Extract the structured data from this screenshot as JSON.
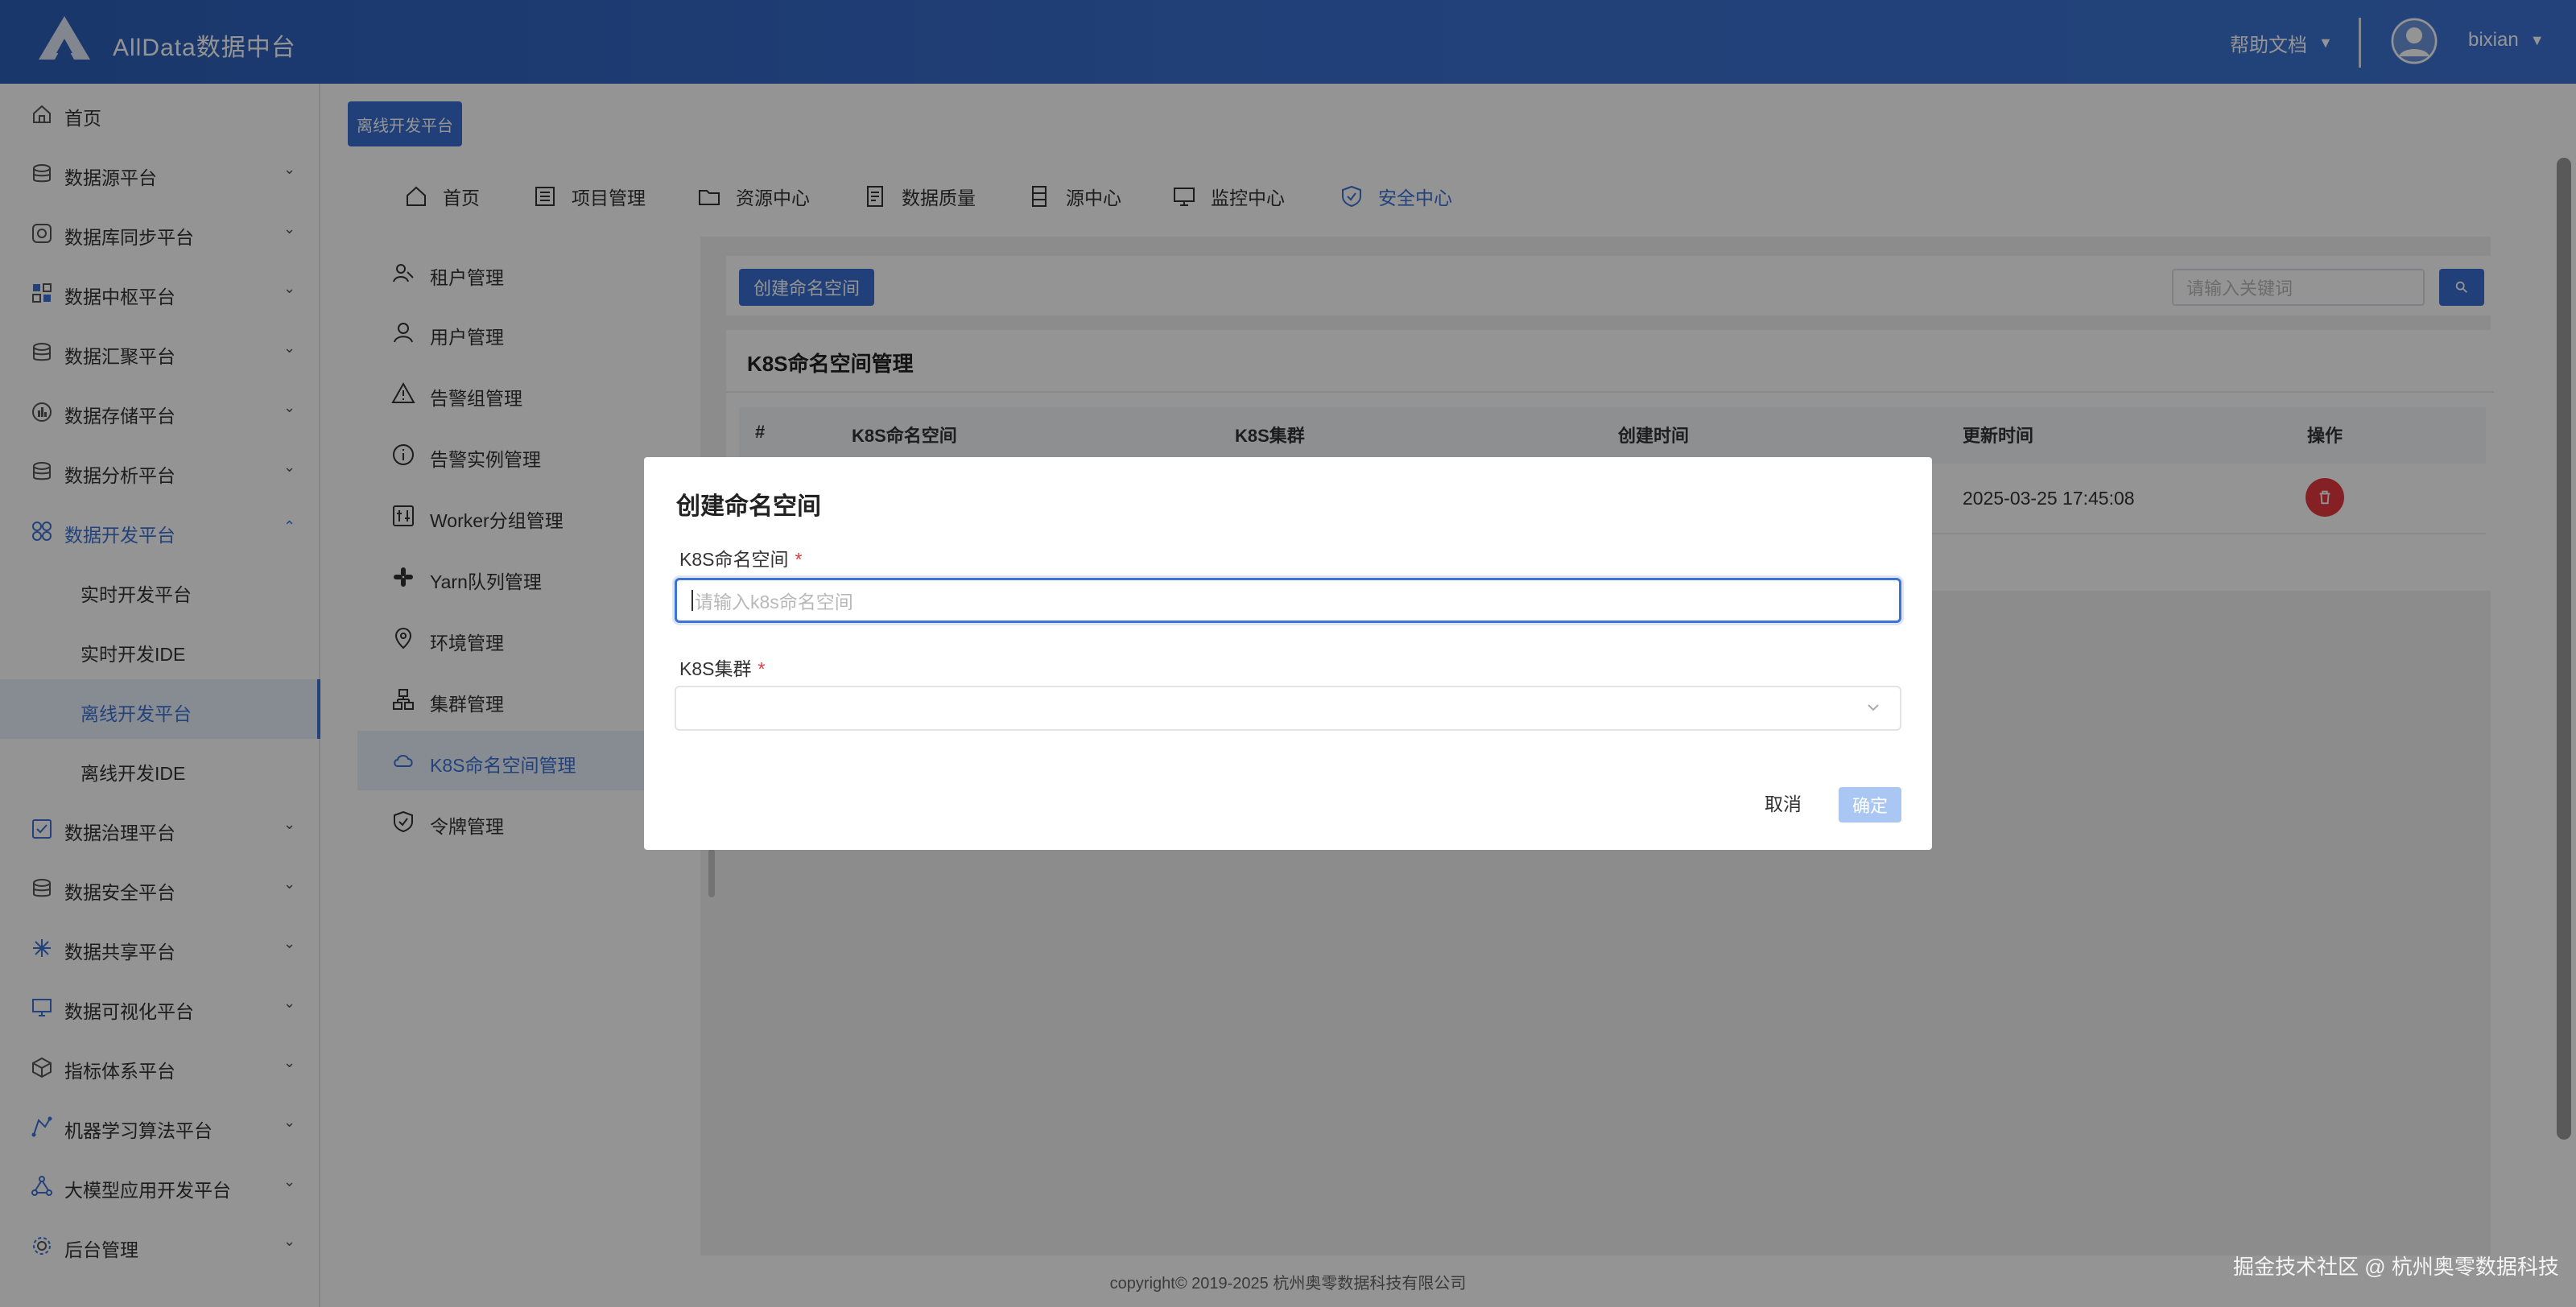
{
  "header": {
    "app_title": "AllData数据中台",
    "help_label": "帮助文档",
    "username": "bixian"
  },
  "sidebar": {
    "items": [
      {
        "label": "首页",
        "icon": "home-icon"
      },
      {
        "label": "数据源平台",
        "icon": "database-icon"
      },
      {
        "label": "数据库同步平台",
        "icon": "sync-icon"
      },
      {
        "label": "数据中枢平台",
        "icon": "grid-icon"
      },
      {
        "label": "数据汇聚平台",
        "icon": "database-icon"
      },
      {
        "label": "数据存储平台",
        "icon": "storage-icon"
      },
      {
        "label": "数据分析平台",
        "icon": "database-icon"
      },
      {
        "label": "数据开发平台",
        "icon": "cluster-icon"
      },
      {
        "label": "实时开发平台"
      },
      {
        "label": "实时开发IDE"
      },
      {
        "label": "离线开发平台"
      },
      {
        "label": "离线开发IDE"
      },
      {
        "label": "数据治理平台",
        "icon": "checklist-icon"
      },
      {
        "label": "数据安全平台",
        "icon": "database-icon"
      },
      {
        "label": "数据共享平台",
        "icon": "share-icon"
      },
      {
        "label": "数据可视化平台",
        "icon": "monitor-icon"
      },
      {
        "label": "指标体系平台",
        "icon": "cube-icon"
      },
      {
        "label": "机器学习算法平台",
        "icon": "ml-icon"
      },
      {
        "label": "大模型应用开发平台",
        "icon": "network-icon"
      },
      {
        "label": "后台管理",
        "icon": "gear-icon"
      }
    ]
  },
  "main": {
    "platform_button": "离线开发平台",
    "top_nav": [
      "首页",
      "项目管理",
      "资源中心",
      "数据质量",
      "源中心",
      "监控中心",
      "安全中心"
    ],
    "sub_nav": [
      "租户管理",
      "用户管理",
      "告警组管理",
      "告警实例管理",
      "Worker分组管理",
      "Yarn队列管理",
      "环境管理",
      "集群管理",
      "K8S命名空间管理",
      "令牌管理"
    ],
    "create_button": "创建命名空间",
    "search_placeholder": "请输入关键词",
    "table_title": "K8S命名空间管理",
    "columns": [
      "#",
      "K8S命名空间",
      "K8S集群",
      "创建时间",
      "更新时间",
      "操作"
    ],
    "row_update_time": "2025-03-25 17:45:08"
  },
  "footer": {
    "copyright": "copyright© 2019-2025 杭州奥零数据科技有限公司",
    "watermark": "掘金技术社区 @ 杭州奥零数据科技"
  },
  "modal": {
    "title": "创建命名空间",
    "namespace_label": "K8S命名空间",
    "namespace_placeholder": "请输入k8s命名空间",
    "cluster_label": "K8S集群",
    "required_mark": "*",
    "cancel_label": "取消",
    "confirm_label": "确定"
  },
  "colors": {
    "primary": "#3d73d4",
    "danger": "#e5393f",
    "confirm_disabled": "#a9c7f2"
  }
}
